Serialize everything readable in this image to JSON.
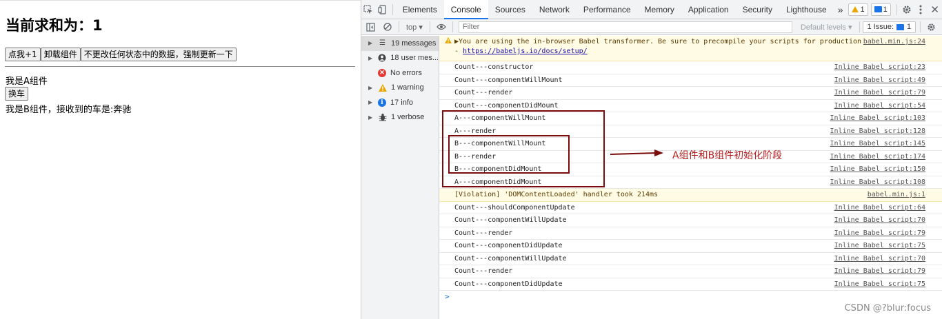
{
  "page": {
    "heading": "当前求和为：1",
    "buttons": [
      "点我+1",
      "卸载组件",
      "不更改任何状态中的数据，强制更新一下"
    ],
    "component_a_text": "我是A组件",
    "swap_button": "换车",
    "component_b_text": "我是B组件，接收到的车是:奔驰"
  },
  "devtools": {
    "tabs": [
      "Elements",
      "Console",
      "Sources",
      "Network",
      "Performance",
      "Memory",
      "Application",
      "Security",
      "Lighthouse"
    ],
    "active_tab": "Console",
    "more_tabs": "»",
    "warning_badge_count": "1",
    "message_badge_count": "1",
    "context_select": "top",
    "filter_placeholder": "Filter",
    "levels_select": "Default levels",
    "issues_label": "1 Issue:",
    "issues_count": "1",
    "sidebar": [
      {
        "label": "19 messages",
        "icon": "list-icon",
        "expandable": true,
        "selected": true
      },
      {
        "label": "18 user mes...",
        "icon": "user-icon",
        "expandable": true
      },
      {
        "label": "No errors",
        "icon": "error-icon",
        "expandable": false
      },
      {
        "label": "1 warning",
        "icon": "warning-icon",
        "expandable": true
      },
      {
        "label": "17 info",
        "icon": "info-icon",
        "expandable": true
      },
      {
        "label": "1 verbose",
        "icon": "bug-icon",
        "expandable": true
      }
    ],
    "babel_warning": {
      "line1": "▶You are using the in-browser Babel transformer. Be sure to precompile your scripts for production",
      "line2_prefix": "- ",
      "link": "https://babeljs.io/docs/setup/",
      "source": "babel.min.js:24"
    },
    "logs": [
      {
        "text": "Count---constructor",
        "source": "Inline Babel script:23"
      },
      {
        "text": "Count---componentWillMount",
        "source": "Inline Babel script:49"
      },
      {
        "text": "Count---render",
        "source": "Inline Babel script:79"
      },
      {
        "text": "Count---componentDidMount",
        "source": "Inline Babel script:54"
      },
      {
        "text": "A---componentWillMount",
        "source": "Inline Babel script:103"
      },
      {
        "text": "A---render",
        "source": "Inline Babel script:128"
      },
      {
        "text": "B---componentWillMount",
        "source": "Inline Babel script:145"
      },
      {
        "text": "B---render",
        "source": "Inline Babel script:174"
      },
      {
        "text": "B---componentDidMount",
        "source": "Inline Babel script:150"
      },
      {
        "text": "A---componentDidMount",
        "source": "Inline Babel script:108"
      },
      {
        "text": "[Violation] 'DOMContentLoaded' handler took 214ms",
        "source": "babel.min.js:1",
        "violation": true
      },
      {
        "text": "Count---shouldComponentUpdate",
        "source": "Inline Babel script:64"
      },
      {
        "text": "Count---componentWillUpdate",
        "source": "Inline Babel script:70"
      },
      {
        "text": "Count---render",
        "source": "Inline Babel script:79"
      },
      {
        "text": "Count---componentDidUpdate",
        "source": "Inline Babel script:75"
      },
      {
        "text": "Count---componentWillUpdate",
        "source": "Inline Babel script:70"
      },
      {
        "text": "Count---render",
        "source": "Inline Babel script:79"
      },
      {
        "text": "Count---componentDidUpdate",
        "source": "Inline Babel script:75"
      }
    ],
    "prompt": ">"
  },
  "annotation": {
    "text": "A组件和B组件初始化阶段",
    "color": "#b81c1c",
    "box_color": "#7b0a0a"
  },
  "watermark": "CSDN @?blur:focus"
}
